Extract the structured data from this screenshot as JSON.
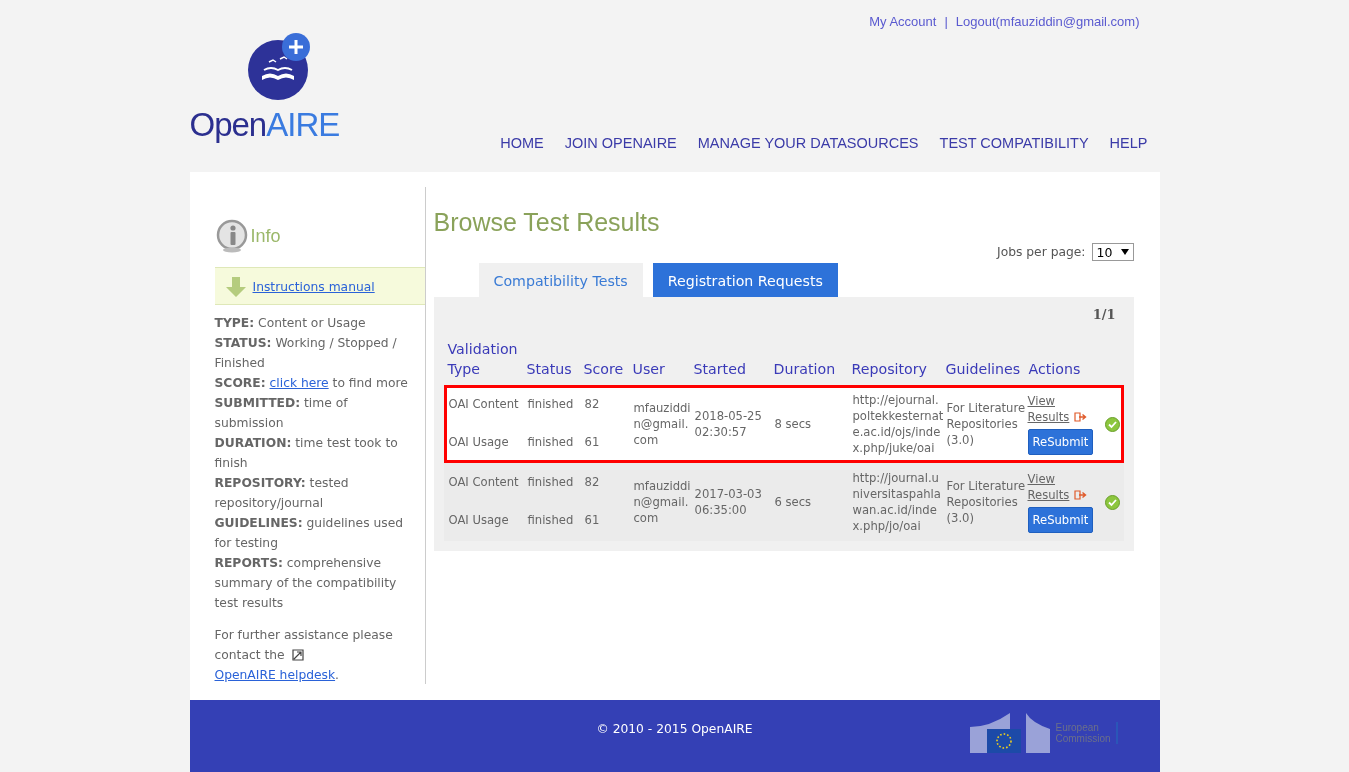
{
  "header": {
    "account_links": [
      "My Account",
      "Logout(mfauziddin@gmail.com)"
    ],
    "separator": "|",
    "logo": {
      "first": "Open",
      "second": "AIRE"
    },
    "nav": [
      "HOME",
      "JOIN OPENAIRE",
      "MANAGE YOUR DATASOURCES",
      "TEST COMPATIBILITY",
      "HELP"
    ]
  },
  "sidebar": {
    "title": "Info",
    "manual": "Instructions manual",
    "definitions": [
      {
        "term": "TYPE:",
        "text": "Content or Usage"
      },
      {
        "term": "STATUS:",
        "text": "Working / Stopped / Finished"
      },
      {
        "term": "SCORE:",
        "link": "click here",
        "text": "to find more"
      },
      {
        "term": "SUBMITTED:",
        "text": "time of submission"
      },
      {
        "term": "DURATION:",
        "text": "time test took to finish"
      },
      {
        "term": "REPOSITORY:",
        "text": "tested repository/journal"
      },
      {
        "term": "GUIDELINES:",
        "text": "guidelines used for testing"
      },
      {
        "term": "REPORTS:",
        "text": "comprehensive summary of the compatibility test results"
      }
    ],
    "assistance": {
      "text": "For further assistance please contact the",
      "link": "OpenAIRE helpdesk",
      "end": "."
    }
  },
  "results": {
    "title": "Browse Test Results",
    "jobs_per_page": {
      "label": "Jobs per page:",
      "value": "10"
    },
    "tabs": [
      {
        "label": "Compatibility Tests",
        "selected": true
      },
      {
        "label": "Registration Requests",
        "selected": false
      }
    ],
    "pagination": "1/1",
    "columns": [
      "Validation Type",
      "Status",
      "Score",
      "User",
      "Started",
      "Duration",
      "Repository",
      "Guidelines",
      "Actions"
    ],
    "rows": [
      {
        "highlighted": true,
        "tests": [
          {
            "type": "OAI Content",
            "status": "finished",
            "score": "82"
          },
          {
            "type": "OAI Usage",
            "status": "finished",
            "score": "61"
          }
        ],
        "user": "mfauziddin@gmail.com",
        "started": "2018-05-25 02:30:57",
        "duration": "8 secs",
        "repository": "http://ejournal.poltekkesternate.ac.id/ojs/index.php/juke/oai",
        "guidelines": "For Literature Repositories (3.0)",
        "view": "View Results",
        "resubmit": "ReSubmit"
      },
      {
        "highlighted": false,
        "tests": [
          {
            "type": "OAI Content",
            "status": "finished",
            "score": "82"
          },
          {
            "type": "OAI Usage",
            "status": "finished",
            "score": "61"
          }
        ],
        "user": "mfauziddin@gmail.com",
        "started": "2017-03-03 06:35:00",
        "duration": "6 secs",
        "repository": "http://journal.universitaspahlawan.ac.id/index.php/jo/oai",
        "guidelines": "For Literature Repositories (3.0)",
        "view": "View Results",
        "resubmit": "ReSubmit"
      }
    ]
  },
  "footer": {
    "copyright": "© 2010 - 2015 OpenAIRE",
    "eu_text": "European Commission"
  }
}
